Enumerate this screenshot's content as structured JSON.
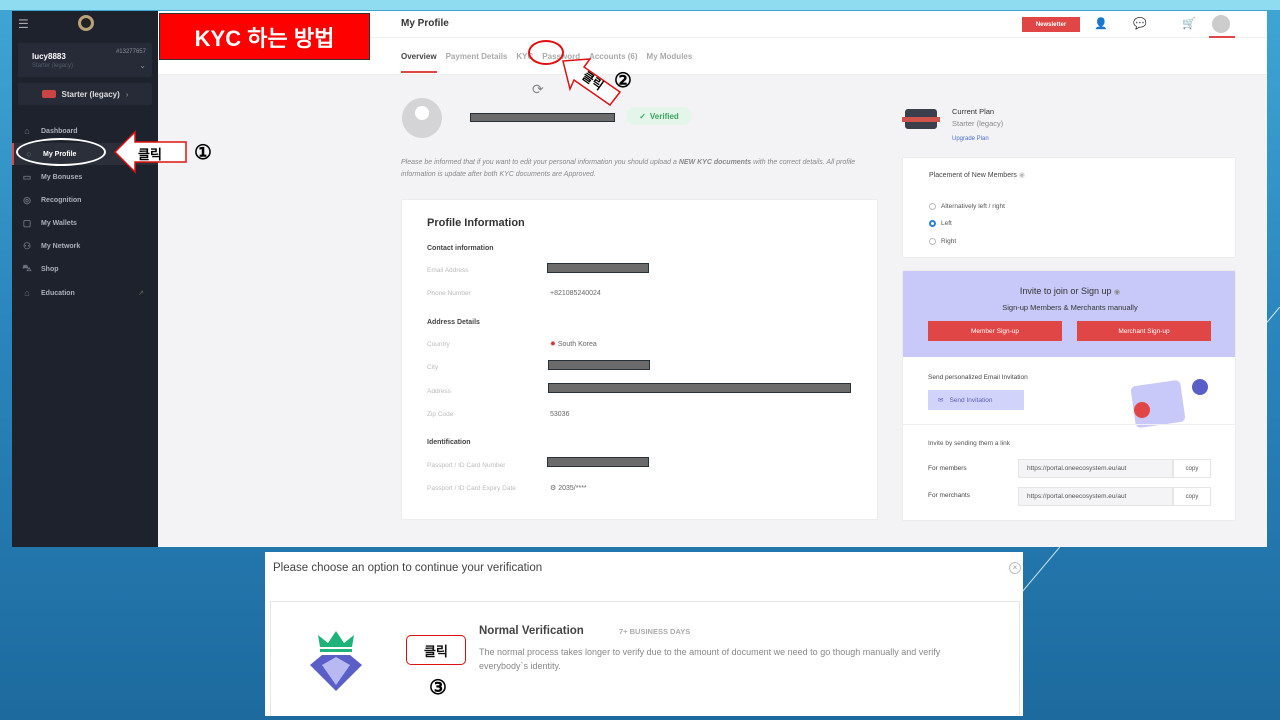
{
  "slide_title": "KYC 하는 방법",
  "annotations": {
    "click_label": "클릭",
    "step1": "①",
    "step2": "②",
    "step3": "③"
  },
  "sidebar": {
    "username": "lucy8883",
    "user_plan": "Starter (legacy)",
    "user_id": "#13277657",
    "plan_button": "Starter (legacy)",
    "items": [
      {
        "label": "Dashboard",
        "icon": "home-icon"
      },
      {
        "label": "My Profile",
        "icon": "user-icon"
      },
      {
        "label": "My Bonuses",
        "icon": "gift-icon"
      },
      {
        "label": "Recognition",
        "icon": "star-icon"
      },
      {
        "label": "My Wallets",
        "icon": "wallet-icon"
      },
      {
        "label": "My Network",
        "icon": "network-icon"
      },
      {
        "label": "Shop",
        "icon": "cart-icon"
      },
      {
        "label": "Education",
        "icon": "education-icon"
      }
    ]
  },
  "header": {
    "title": "My Profile",
    "newsletter": "Newsletter",
    "tabs": [
      "Overview",
      "Payment Details",
      "KYC",
      "Password",
      "Accounts (6)",
      "My Modules"
    ]
  },
  "profile": {
    "status": "Verified",
    "notice_pre": "Please be informed that if you want to edit your personal information you should upload a ",
    "notice_bold": "NEW KYC documents",
    "notice_post": " with the correct details. All profile information is update after both KYC documents are Approved."
  },
  "profile_info": {
    "title": "Profile Information",
    "contact_heading": "Contact information",
    "email_label": "Email Address",
    "phone_label": "Phone Number",
    "phone": "+821085240024",
    "address_heading": "Address Details",
    "country_label": "Country",
    "country": "South Korea",
    "city_label": "City",
    "address_label": "Address",
    "zip_label": "Zip Code",
    "zip": "53036",
    "id_heading": "Identification",
    "passport_label": "Passport / ID Card Number",
    "expiry_label": "Passport / ID Card Expiry Date",
    "expiry": "2035/****"
  },
  "current_plan": {
    "label": "Current Plan",
    "value": "Starter (legacy)",
    "upgrade": "Upgrade Plan"
  },
  "placement": {
    "title": "Placement of New Members",
    "options": [
      "Alternatively left / right",
      "Left",
      "Right"
    ],
    "selected": "Left"
  },
  "invite": {
    "title": "Invite to join or Sign up",
    "subtitle": "Sign-up Members & Merchants manually",
    "member_btn": "Member Sign-up",
    "merchant_btn": "Merchant Sign-up",
    "email_heading": "Send personalized Email Invitation",
    "send_btn": "Send Invitation",
    "link_heading": "Invite by sending them a link",
    "members_label": "For members",
    "merchants_label": "For merchants",
    "members_link": "https://portal.oneecosystem.eu/aut",
    "merchants_link": "https://portal.oneecosystem.eu/aut",
    "copy": "copy"
  },
  "dialog": {
    "title": "Please choose an option to continue your verification",
    "option_title": "Normal Verification",
    "option_badge": "7+ BUSINESS DAYS",
    "option_desc": "The normal process takes longer to verify due to the amount of document we need to go though manually and verify everybody`s identity."
  },
  "colors": {
    "accent": "#e04646",
    "sidebar": "#1e222c",
    "invite_bg": "#c8c9f8"
  }
}
